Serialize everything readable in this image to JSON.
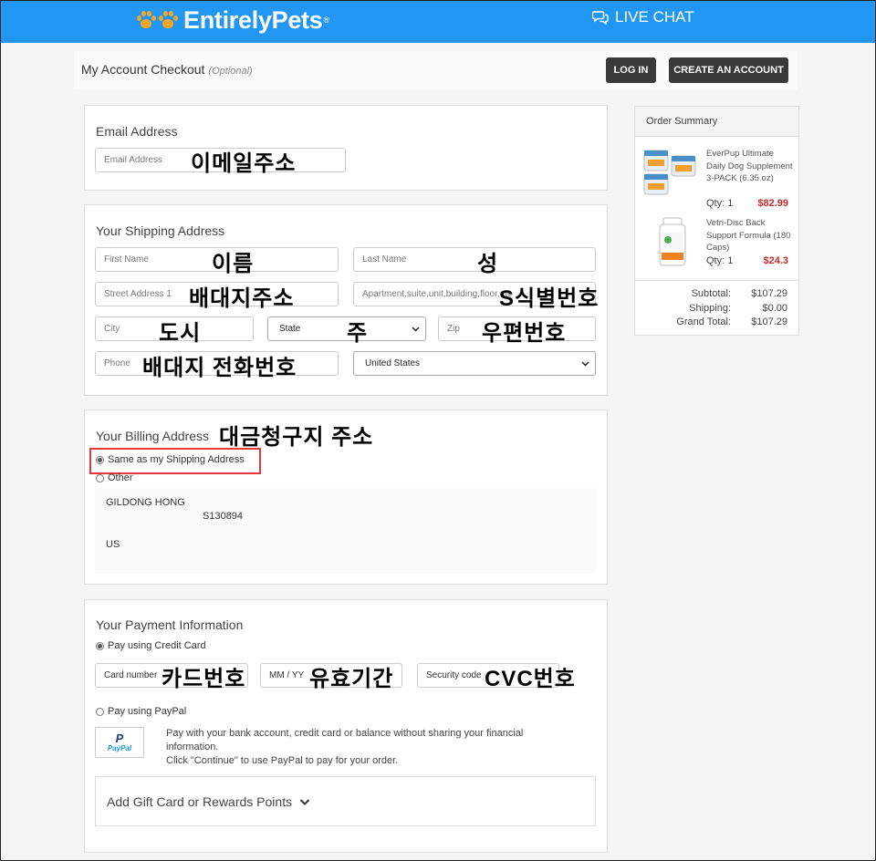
{
  "header": {
    "brand": "EntirelyPets",
    "brand_mark": "®",
    "live_chat": "LIVE CHAT"
  },
  "account": {
    "title": "My Account Checkout",
    "optional": "(Optional)",
    "login": "LOG IN",
    "create": "CREATE AN ACCOUNT"
  },
  "email_section": {
    "title": "Email Address",
    "email_placeholder": "Email Address",
    "note": "이메일주소"
  },
  "shipping": {
    "title": "Your Shipping Address",
    "first_name": "First Name",
    "last_name": "Last Name",
    "street": "Street Address 1",
    "apt": "Apartment,suite,unit,building,floor,etc",
    "city": "City",
    "state": "State",
    "zip": "Zip",
    "phone": "Phone",
    "country": "United States",
    "notes": {
      "first_name": "이름",
      "last_name": "성",
      "street": "배대지주소",
      "apt": "S식별번호",
      "city": "도시",
      "state": "주",
      "zip": "우편번호",
      "phone": "배대지 전화번호"
    }
  },
  "billing": {
    "title": "Your Billing Address",
    "note": "대금청구지 주소",
    "same_option": "Same as my Shipping Address",
    "other_option": "Other",
    "address": {
      "name": "GILDONG HONG",
      "line": "S130894",
      "country": "US"
    }
  },
  "payment": {
    "title": "Your Payment Information",
    "credit_option": "Pay using Credit Card",
    "card_number": "Card number",
    "expiry": "MM / YY",
    "security": "Security code",
    "notes": {
      "card_number": "카드번호",
      "expiry": "유효기간",
      "security": "CVC번호"
    },
    "paypal_option": "Pay using PayPal",
    "paypal_logo": "PayPal",
    "paypal_desc_1": "Pay with your bank account, credit card or balance without sharing your financial information.",
    "paypal_desc_2": "Click \"Continue\" to use PayPal to pay for your order.",
    "gift": "Add Gift Card or Rewards Points"
  },
  "order_summary": {
    "title": "Order Summary",
    "items": [
      {
        "name": "EverPup Ultimate Daily Dog Supplement 3-PACK (6.35 oz)",
        "qty": "Qty: 1",
        "price": "$82.99"
      },
      {
        "name": "Vetri-Disc Back Support Formula (180 Caps)",
        "qty": "Qty: 1",
        "price": "$24.3"
      }
    ],
    "subtotal_label": "Subtotal:",
    "subtotal": "$107.29",
    "shipping_label": "Shipping:",
    "shipping": "$0.00",
    "grand_label": "Grand Total:",
    "grand": "$107.29"
  }
}
